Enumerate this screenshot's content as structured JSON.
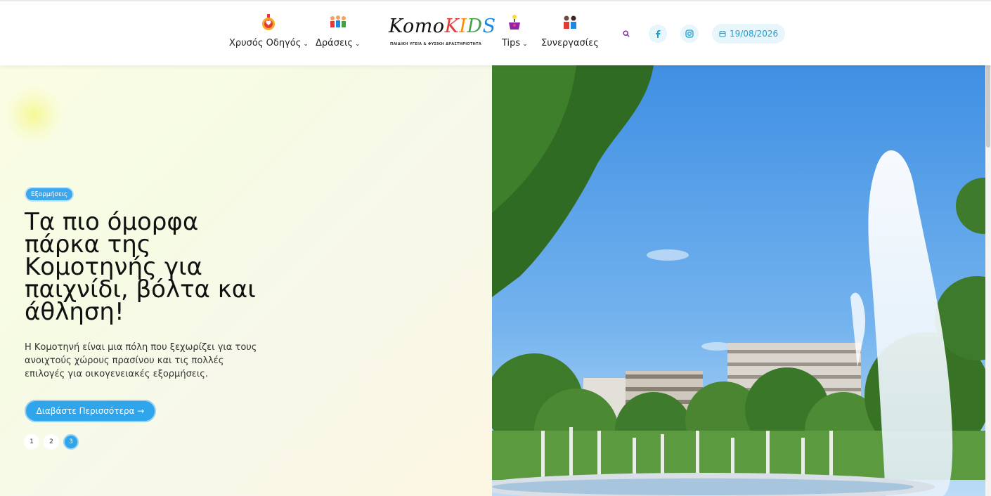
{
  "nav": {
    "items": [
      {
        "label": "Χρυσός Οδηγός",
        "icon": "gold-medal-icon"
      },
      {
        "label": "Δράσεις",
        "icon": "kids-group-icon"
      },
      {
        "label": "Tips",
        "icon": "lightbulb-cup-icon"
      },
      {
        "label": "Συνεργασίες",
        "icon": "kids-pair-icon"
      }
    ],
    "chevron": "⌄"
  },
  "logo": {
    "word_part1": "Komo",
    "word_k": "K",
    "word_i": "I",
    "word_d": "D",
    "word_s": "S",
    "subtitle": "ΠΑΙΔΙΚΗ ΥΓΕΙΑ & ΦΥΣΙΚΗ ΔΡΑΣΤΗΡΙΟΤΗΤΑ"
  },
  "header": {
    "date": "19/08/2026",
    "icons": [
      "search-icon",
      "facebook-icon",
      "instagram-icon",
      "calendar-icon"
    ]
  },
  "hero": {
    "category": "Εξορμήσεις",
    "title": "Τα πιο όμορφα πάρκα της Κομοτηνής για παιχνίδι, βόλτα και άθληση!",
    "description": "Η Κομοτηνή είναι μια πόλη που ξεχωρίζει για τους ανοιχτούς χώρους πρασίνου και τις πολλές επιλογές για οικογενειακές εξορμήσεις.",
    "cta": "Διαβάστε Περισσότερα →",
    "pages": [
      "1",
      "2",
      "3"
    ],
    "active_page": "3"
  },
  "colors": {
    "accent": "#2fa5eb",
    "date_text": "#1a9fd6"
  }
}
